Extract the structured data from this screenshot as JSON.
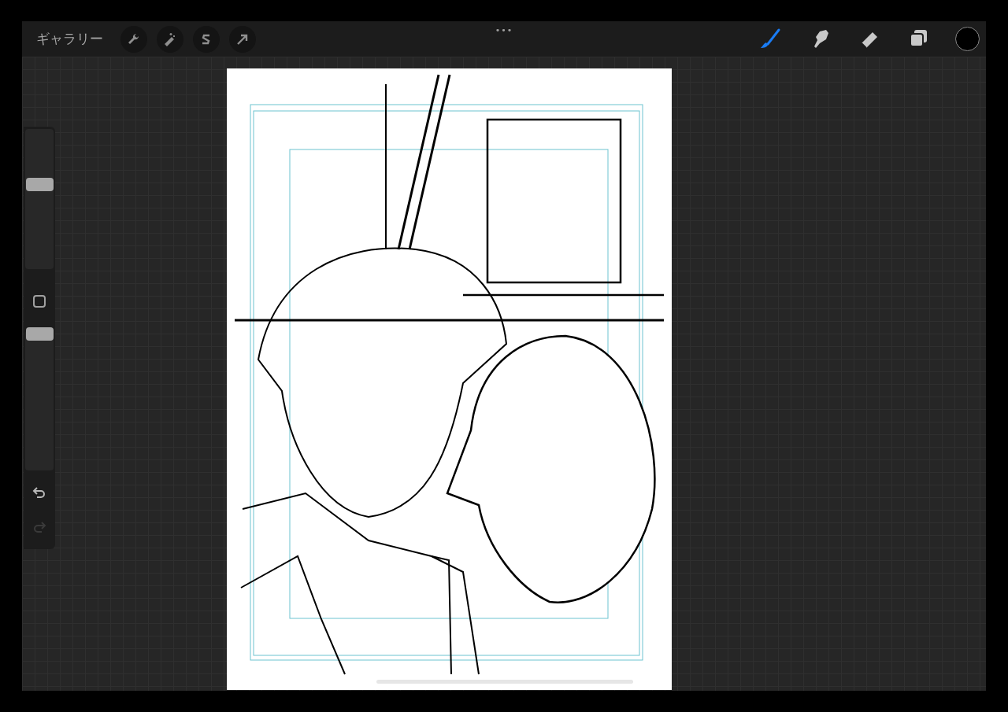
{
  "top_bar": {
    "gallery_label": "ギャラリー",
    "actions": [
      {
        "kind": "wrench"
      },
      {
        "kind": "wand"
      },
      {
        "kind": "selection"
      },
      {
        "kind": "transform"
      }
    ],
    "more": "•••",
    "tools": [
      {
        "kind": "brush",
        "selected": true
      },
      {
        "kind": "smudge",
        "selected": false
      },
      {
        "kind": "eraser",
        "selected": false
      },
      {
        "kind": "layers",
        "selected": false
      }
    ],
    "color": "#000000"
  },
  "sidebar": {
    "size_slider": {
      "level": 0.6
    },
    "modify_button": {
      "kind": "square"
    },
    "opacity_slider": {
      "level": 0.97
    },
    "undo": {
      "disabled": false
    },
    "redo": {
      "disabled": true
    }
  }
}
